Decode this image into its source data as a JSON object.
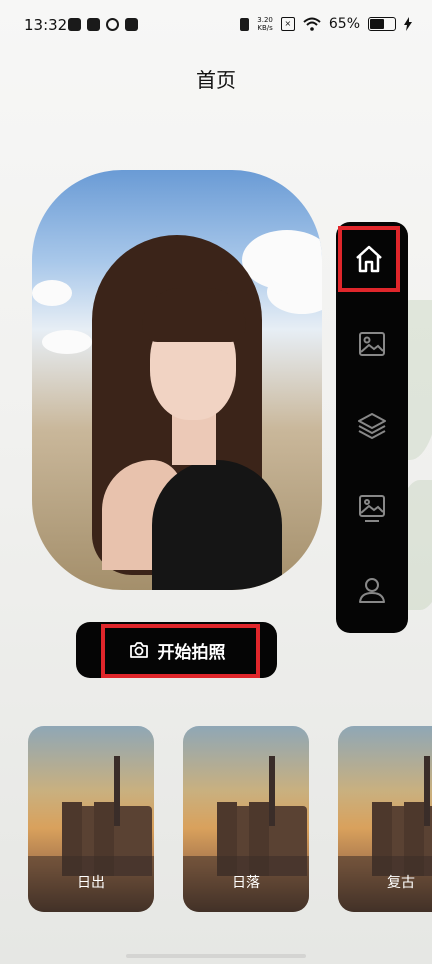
{
  "status_bar": {
    "time": "13:32",
    "net_speed_value": "3.20",
    "net_speed_unit": "KB/s",
    "sim_icon_text": "×",
    "battery_percent": "65%",
    "battery_level": 0.65
  },
  "page": {
    "title": "首页"
  },
  "side_nav": {
    "items": [
      {
        "icon": "home-icon",
        "active": true
      },
      {
        "icon": "image-icon",
        "active": false
      },
      {
        "icon": "layers-icon",
        "active": false
      },
      {
        "icon": "gallery-icon",
        "active": false
      },
      {
        "icon": "profile-icon",
        "active": false
      }
    ],
    "active_color": "#e0262b"
  },
  "start_button": {
    "label": "开始拍照",
    "icon": "camera-icon"
  },
  "filters": [
    {
      "label": "日出"
    },
    {
      "label": "日落"
    },
    {
      "label": "复古"
    }
  ]
}
